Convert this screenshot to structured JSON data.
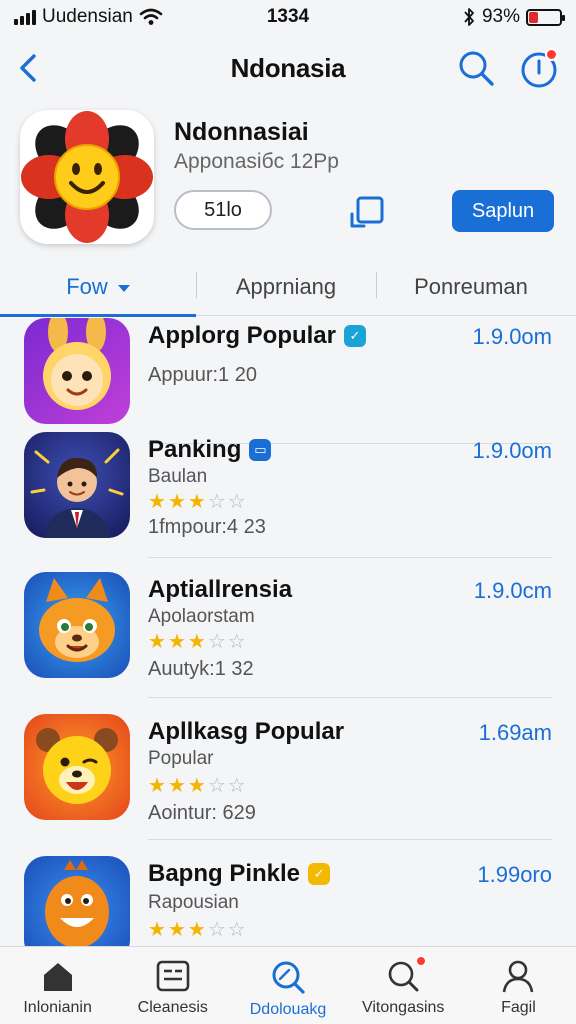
{
  "status_bar": {
    "carrier": "Uudensian",
    "time": "1334",
    "battery_text": "93%",
    "battery_level": 0.3,
    "icons": [
      "signal-icon",
      "wifi-icon",
      "bluetooth-icon",
      "battery-icon"
    ]
  },
  "nav": {
    "title": "Ndonasia",
    "icons": [
      "back-icon",
      "search-icon",
      "info-icon"
    ]
  },
  "app": {
    "name": "Ndonnasiai",
    "subtitle": "Apponasiбc 12Pp",
    "pill_label": "51lo",
    "primary_label": "Saplun",
    "accent": "#1a6fd6"
  },
  "tabs": [
    {
      "label": "Fow",
      "active": true
    },
    {
      "label": "Apprniang",
      "active": false
    },
    {
      "label": "Ponreuman",
      "active": false
    }
  ],
  "list": [
    {
      "title": "Applorg Popular",
      "badge_color": "#1aa3d6",
      "price": "1.9.0om",
      "lines": [
        "Appuur:1 20"
      ],
      "rating": null
    },
    {
      "title": "Panking",
      "badge_color": "#1a6fd6",
      "price": "1.9.0om",
      "lines": [
        "Baulan",
        "1fmpour:4 23"
      ],
      "rating": 3.5
    },
    {
      "title": "Aptiallrensia",
      "badge_color": null,
      "price": "1.9.0cm",
      "lines": [
        "Apolaorstam",
        "Auutyk:1 32"
      ],
      "rating": 3.5
    },
    {
      "title": "Apllkasg Popular",
      "badge_color": null,
      "price": "1.69am",
      "lines": [
        "Popular",
        "Aointur: 629"
      ],
      "rating": 3.5
    },
    {
      "title": "Bapng Pinkle",
      "badge_color": "#f3b900",
      "price": "1.99oro",
      "lines": [
        "Rapousian"
      ],
      "rating": 3.5
    }
  ],
  "bottom_tabs": [
    {
      "label": "Inlonianin",
      "icon": "home-icon",
      "active": false,
      "badge": false
    },
    {
      "label": "Cleanesis",
      "icon": "categories-icon",
      "active": false,
      "badge": false
    },
    {
      "label": "Ddolouakg",
      "icon": "search-icon",
      "active": true,
      "badge": false
    },
    {
      "label": "Vitongasins",
      "icon": "notifications-search-icon",
      "active": false,
      "badge": true
    },
    {
      "label": "Fagil",
      "icon": "profile-icon",
      "active": false,
      "badge": false
    }
  ]
}
